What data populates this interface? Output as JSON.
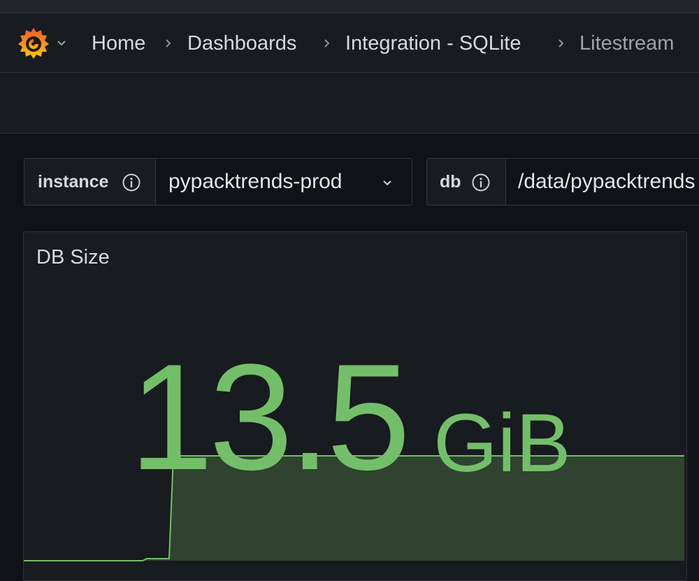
{
  "breadcrumbs": [
    {
      "label": "Home"
    },
    {
      "label": "Dashboards"
    },
    {
      "label": "Integration - SQLite"
    },
    {
      "label": "Litestream"
    }
  ],
  "variables": [
    {
      "label": "instance",
      "value": "pypacktrends-prod",
      "icon": "info-icon"
    },
    {
      "label": "db",
      "value": "/data/pypacktrends",
      "icon": "info-icon"
    }
  ],
  "panel": {
    "title": "DB Size",
    "stat_value": "13.5",
    "stat_unit": "GiB",
    "color": "#73bf69"
  },
  "colors": {
    "stat_green": "#73bf69",
    "logo_orange": "#f05a28",
    "logo_yellow": "#fbca0a"
  }
}
